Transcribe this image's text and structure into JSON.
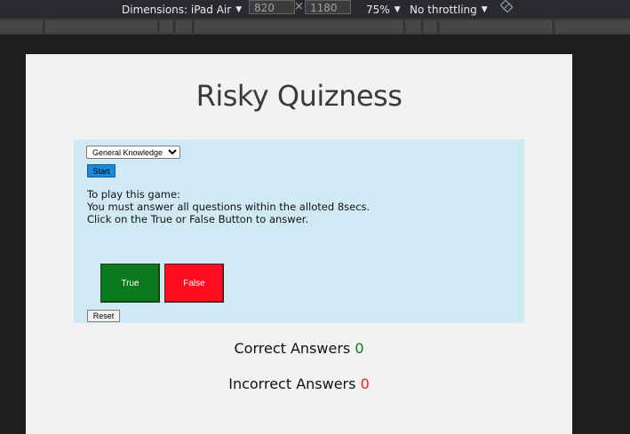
{
  "devtools": {
    "dimensions_label": "Dimensions: iPad Air",
    "width_value": "820",
    "height_value": "1180",
    "times_symbol": "×",
    "zoom_label": "75%",
    "throttling_label": "No throttling",
    "caret": "▼"
  },
  "page": {
    "title": "Risky Quizness",
    "category_options": [
      "General Knowledge"
    ],
    "category_selected": "General Knowledge",
    "start_label": "Start",
    "instructions": [
      "To play this game:",
      "You must answer all questions within the alloted 8secs.",
      "Click on the True or False Button to answer."
    ],
    "true_label": "True",
    "false_label": "False",
    "reset_label": "Reset",
    "correct_label": "Correct Answers",
    "correct_count": "0",
    "incorrect_label": "Incorrect Answers",
    "incorrect_count": "0"
  },
  "colors": {
    "true_button": "#0b7a1e",
    "false_button": "#ff0d1f",
    "panel": "#cfeaf4",
    "start_button": "#1a8ad8"
  }
}
